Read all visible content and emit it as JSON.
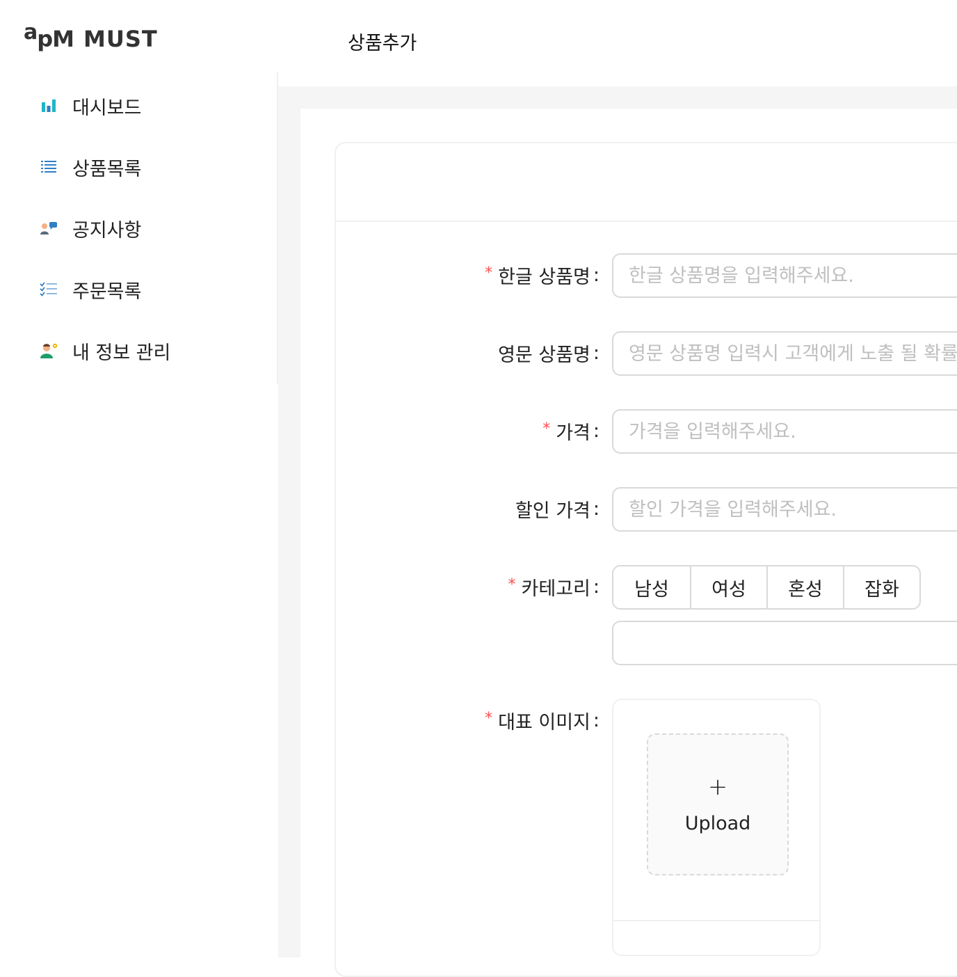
{
  "logo": {
    "a": "a",
    "pm": "pM",
    "must": "MUST"
  },
  "header": {
    "title": "상품추가"
  },
  "sidebar": {
    "items": [
      {
        "label": "대시보드",
        "icon": "bar-chart-icon"
      },
      {
        "label": "상품목록",
        "icon": "list-icon"
      },
      {
        "label": "공지사항",
        "icon": "people-chat-icon"
      },
      {
        "label": "주문목록",
        "icon": "checklist-icon"
      },
      {
        "label": "내 정보 관리",
        "icon": "user-settings-icon"
      }
    ]
  },
  "form": {
    "korean_name": {
      "label": "한글 상품명",
      "placeholder": "한글 상품명을 입력해주세요.",
      "required": true
    },
    "english_name": {
      "label": "영문 상품명",
      "placeholder": "영문 상품명 입력시 고객에게 노출 될 확률 을",
      "required": false
    },
    "price": {
      "label": "가격",
      "placeholder": "가격을 입력해주세요.",
      "required": true
    },
    "discount_price": {
      "label": "할인 가격",
      "placeholder": "할인 가격을 입력해주세요.",
      "required": false
    },
    "category": {
      "label": "카테고리",
      "required": true,
      "options": [
        "남성",
        "여성",
        "혼성",
        "잡화"
      ],
      "extra_value": ""
    },
    "main_image": {
      "label": "대표 이미지",
      "required": true,
      "upload_label": "Upload",
      "upload_icon": "+"
    },
    "required_mark": "*",
    "colon": ":"
  },
  "colors": {
    "accent_required": "#ff4d4f",
    "icon_teal": "#1fb6c9",
    "icon_blue": "#2f7fc6",
    "border": "#d9d9d9",
    "content_bg": "#f5f5f5"
  }
}
